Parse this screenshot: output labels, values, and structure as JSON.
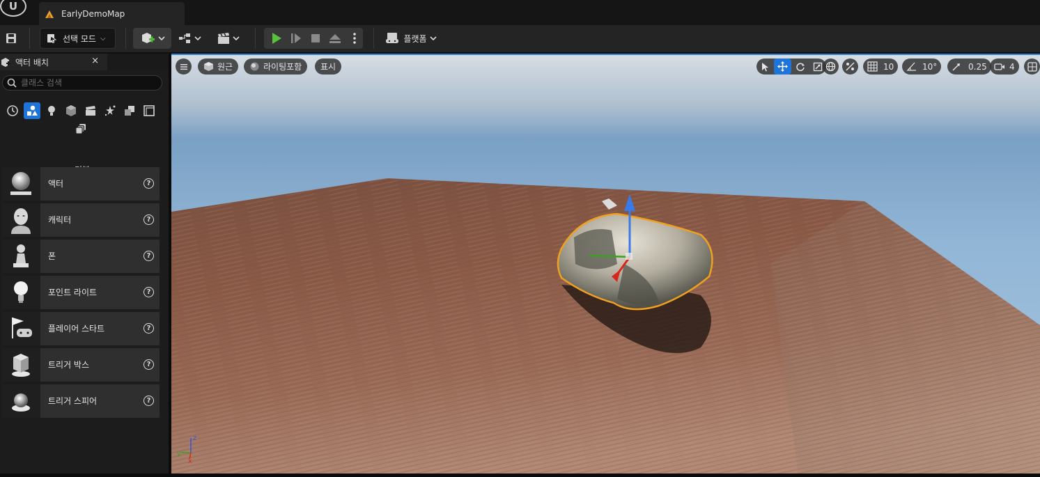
{
  "titlebar": {
    "logo": "unreal-logo",
    "tab_title": "EarlyDemoMap"
  },
  "toolbar": {
    "save_icon": "save-icon",
    "mode_label": "선택 모드",
    "platform_label": "플랫폼"
  },
  "left_panel": {
    "tab_title": "액터 배치",
    "close_glyph": "×",
    "search_placeholder": "클래스 검색",
    "category_label": "기본",
    "categories": [
      {
        "icon": "recent-clock-icon"
      },
      {
        "icon": "basic-shapes-icon",
        "active": true
      },
      {
        "icon": "light-bulb-icon"
      },
      {
        "icon": "cube-icon"
      },
      {
        "icon": "cinematic-clapper-icon"
      },
      {
        "icon": "visual-effects-icon"
      },
      {
        "icon": "geometry-icon"
      },
      {
        "icon": "volumes-icon"
      },
      {
        "icon": "all-classes-icon"
      }
    ],
    "actors": [
      {
        "name": "액터",
        "icon": "actor-sphere-icon"
      },
      {
        "name": "캐릭터",
        "icon": "character-head-icon"
      },
      {
        "name": "폰",
        "icon": "pawn-icon"
      },
      {
        "name": "포인트 라이트",
        "icon": "point-light-icon"
      },
      {
        "name": "플레이어 스타트",
        "icon": "player-start-icon"
      },
      {
        "name": "트리거 박스",
        "icon": "trigger-box-icon"
      },
      {
        "name": "트리거 스피어",
        "icon": "trigger-sphere-icon"
      }
    ],
    "help_glyph": "?"
  },
  "viewport": {
    "perspective_label": "원근",
    "lighting_label": "라이팅포함",
    "show_label": "표시",
    "grid_snap": "10",
    "rotation_snap": "10°",
    "scale_snap": "0.25",
    "camera_speed": "4",
    "axis_x": "x",
    "axis_y": "y",
    "axis_z": "z",
    "colors": {
      "accent": "#1e74d8",
      "selection_outline": "#f0a020",
      "gizmo_z": "#3a7ae8",
      "gizmo_x": "#d8281c",
      "gizmo_y": "#3aa020"
    }
  }
}
